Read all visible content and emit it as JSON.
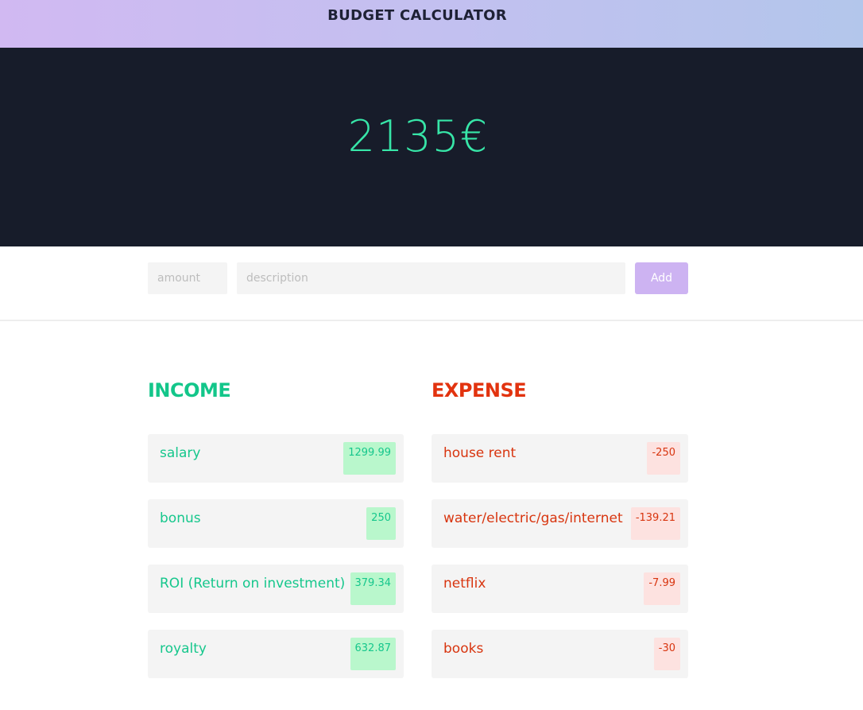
{
  "header": {
    "title": "BUDGET CALCULATOR"
  },
  "balance": {
    "value": "2135€"
  },
  "form": {
    "amount_placeholder": "amount",
    "description_placeholder": "description",
    "add_label": "Add"
  },
  "income": {
    "title": "INCOME",
    "items": [
      {
        "description": "salary",
        "amount": "1299.99"
      },
      {
        "description": "bonus",
        "amount": "250"
      },
      {
        "description": "ROI (Return on investment)",
        "amount": "379.34"
      },
      {
        "description": "royalty",
        "amount": "632.87"
      }
    ]
  },
  "expense": {
    "title": "EXPENSE",
    "items": [
      {
        "description": "house rent",
        "amount": "-250"
      },
      {
        "description": "water/electric/gas/internet",
        "amount": "-139.21"
      },
      {
        "description": "netflix",
        "amount": "-7.99"
      },
      {
        "description": "books",
        "amount": "-30"
      }
    ]
  },
  "colors": {
    "income": "#16c78c",
    "expense": "#d8350f",
    "balance": "#37e6a8",
    "panel": "#171c2a",
    "accent": "#cdb3f2"
  }
}
